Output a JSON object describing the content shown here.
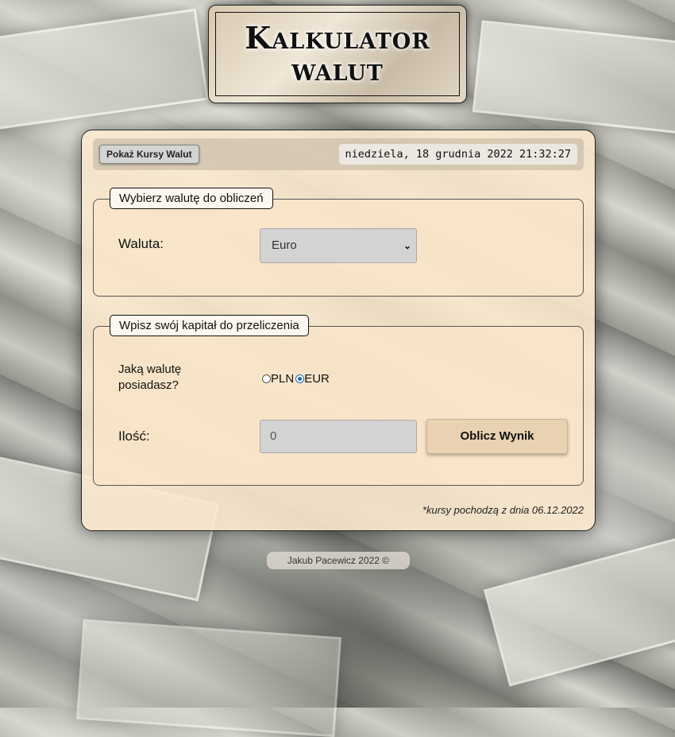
{
  "header": {
    "title_line1": "Kalkulator",
    "title_line2": "walut"
  },
  "topbar": {
    "rates_button": "Pokaż Kursy Walut",
    "datetime": "niedziela, 18 grudnia 2022 21:32:27"
  },
  "currency_section": {
    "legend": "Wybierz walutę do obliczeń",
    "label": "Waluta:",
    "selected_currency": "Euro"
  },
  "capital_section": {
    "legend": "Wpisz swój kapitał do przeliczenia",
    "question_line1": "Jaką walutę",
    "question_line2": "posiadasz?",
    "options": [
      {
        "label": "PLN",
        "checked": false
      },
      {
        "label": "EUR",
        "checked": true
      }
    ],
    "amount_label": "Ilość:",
    "amount_value": "0",
    "calculate_button": "Oblicz Wynik"
  },
  "rates_note": "*kursy pochodzą z dnia 06.12.2022",
  "footer": "Jakub Pacewicz 2022 ©",
  "colors": {
    "panel": "#fae8cd",
    "accent_radio": "#1c66c4",
    "button": "#e8d2b2"
  }
}
